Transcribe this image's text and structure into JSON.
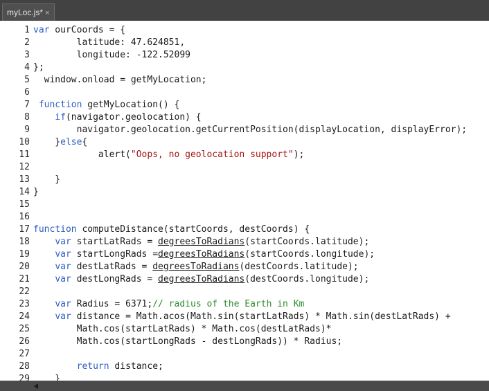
{
  "tab": {
    "label": "myLoc.js*",
    "close": "×"
  },
  "lines": [
    {
      "n": "1",
      "code": [
        {
          "t": "var",
          "c": "kw"
        },
        {
          "t": " ourCoords = {"
        }
      ]
    },
    {
      "n": "2",
      "code": [
        {
          "t": "        latitude: 47.624851,"
        }
      ]
    },
    {
      "n": "3",
      "code": [
        {
          "t": "        longitude: -122.52099"
        }
      ]
    },
    {
      "n": "4",
      "code": [
        {
          "t": "};"
        }
      ]
    },
    {
      "n": "5",
      "code": [
        {
          "t": "  window.onload = getMyLocation;"
        }
      ]
    },
    {
      "n": "6",
      "code": [
        {
          "t": ""
        }
      ]
    },
    {
      "n": "7",
      "code": [
        {
          "t": " "
        },
        {
          "t": "function",
          "c": "kw"
        },
        {
          "t": " getMyLocation() {"
        }
      ]
    },
    {
      "n": "8",
      "code": [
        {
          "t": "    "
        },
        {
          "t": "if",
          "c": "kw"
        },
        {
          "t": "(navigator.geolocation) {"
        }
      ]
    },
    {
      "n": "9",
      "code": [
        {
          "t": "        navigator.geolocation.getCurrentPosition(displayLocation, displayError);"
        }
      ]
    },
    {
      "n": "10",
      "code": [
        {
          "t": "    }"
        },
        {
          "t": "else",
          "c": "kw"
        },
        {
          "t": "{"
        }
      ]
    },
    {
      "n": "11",
      "code": [
        {
          "t": "            alert("
        },
        {
          "t": "\"Oops, no geolocation support\"",
          "c": "str"
        },
        {
          "t": ");"
        }
      ]
    },
    {
      "n": "12",
      "code": [
        {
          "t": ""
        }
      ]
    },
    {
      "n": "13",
      "code": [
        {
          "t": "    }"
        }
      ]
    },
    {
      "n": "14",
      "code": [
        {
          "t": "}"
        }
      ]
    },
    {
      "n": "15",
      "code": [
        {
          "t": ""
        }
      ]
    },
    {
      "n": "16",
      "code": [
        {
          "t": ""
        }
      ]
    },
    {
      "n": "17",
      "code": [
        {
          "t": "function",
          "c": "kw"
        },
        {
          "t": " computeDistance(startCoords, destCoords) {"
        }
      ]
    },
    {
      "n": "18",
      "code": [
        {
          "t": "    "
        },
        {
          "t": "var",
          "c": "kw"
        },
        {
          "t": " startLatRads = "
        },
        {
          "t": "degreesToRadians",
          "c": "ul"
        },
        {
          "t": "(startCoords.latitude);"
        }
      ]
    },
    {
      "n": "19",
      "code": [
        {
          "t": "    "
        },
        {
          "t": "var",
          "c": "kw"
        },
        {
          "t": " startLongRads ="
        },
        {
          "t": "degreesToRadians",
          "c": "ul"
        },
        {
          "t": "(startCoords.longitude);"
        }
      ]
    },
    {
      "n": "20",
      "code": [
        {
          "t": "    "
        },
        {
          "t": "var",
          "c": "kw"
        },
        {
          "t": " destLatRads = "
        },
        {
          "t": "degreesToRadians",
          "c": "ul"
        },
        {
          "t": "(destCoords.latitude);"
        }
      ]
    },
    {
      "n": "21",
      "code": [
        {
          "t": "    "
        },
        {
          "t": "var",
          "c": "kw"
        },
        {
          "t": " destLongRads = "
        },
        {
          "t": "degreesToRadians",
          "c": "ul"
        },
        {
          "t": "(destCoords.longitude);"
        }
      ]
    },
    {
      "n": "22",
      "code": [
        {
          "t": ""
        }
      ]
    },
    {
      "n": "23",
      "code": [
        {
          "t": "    "
        },
        {
          "t": "var",
          "c": "kw"
        },
        {
          "t": " Radius = 6371;"
        },
        {
          "t": "// radius of the Earth in Km",
          "c": "cm"
        }
      ]
    },
    {
      "n": "24",
      "code": [
        {
          "t": "    "
        },
        {
          "t": "var",
          "c": "kw"
        },
        {
          "t": " distance = Math.acos(Math.sin(startLatRads) * Math.sin(destLatRads) +"
        }
      ]
    },
    {
      "n": "25",
      "code": [
        {
          "t": "        Math.cos(startLatRads) * Math.cos(destLatRads)*"
        }
      ]
    },
    {
      "n": "26",
      "code": [
        {
          "t": "        Math.cos(startLongRads - destLongRads)) * Radius;"
        }
      ]
    },
    {
      "n": "27",
      "code": [
        {
          "t": ""
        }
      ]
    },
    {
      "n": "28",
      "code": [
        {
          "t": "        "
        },
        {
          "t": "return",
          "c": "kw"
        },
        {
          "t": " distance;"
        }
      ]
    },
    {
      "n": "29",
      "code": [
        {
          "t": "    }"
        }
      ]
    }
  ]
}
